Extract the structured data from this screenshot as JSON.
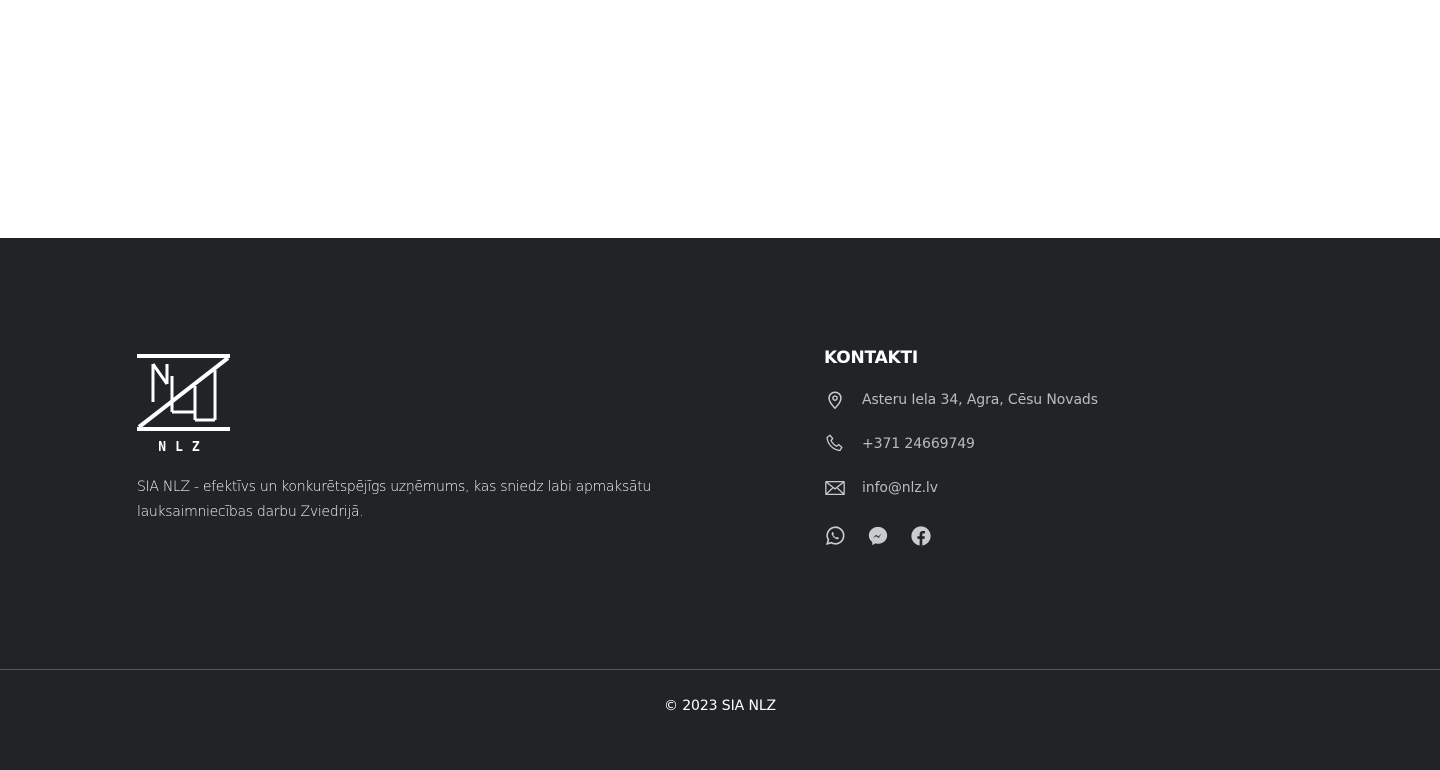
{
  "brand": {
    "logo_text": "NLZ",
    "description": "SIA NLZ - efektīvs un konkurētspējīgs uzņēmums, kas sniedz labi apmaksātu lauksaimniecības darbu Zviedrijā."
  },
  "contacts": {
    "title": "KONTAKTI",
    "address": "Asteru Iela 34, Agra, Cēsu Novads",
    "phone": "+371 24669749",
    "email": "info@nlz.lv",
    "social": [
      {
        "icon": "whatsapp-icon"
      },
      {
        "icon": "messenger-icon"
      },
      {
        "icon": "facebook-icon"
      }
    ]
  },
  "footer": {
    "copyright": "© 2023 SIA NLZ"
  },
  "colors": {
    "footer_bg": "#212427",
    "text_muted": "#b9bcbf",
    "divider": "#54585c"
  }
}
